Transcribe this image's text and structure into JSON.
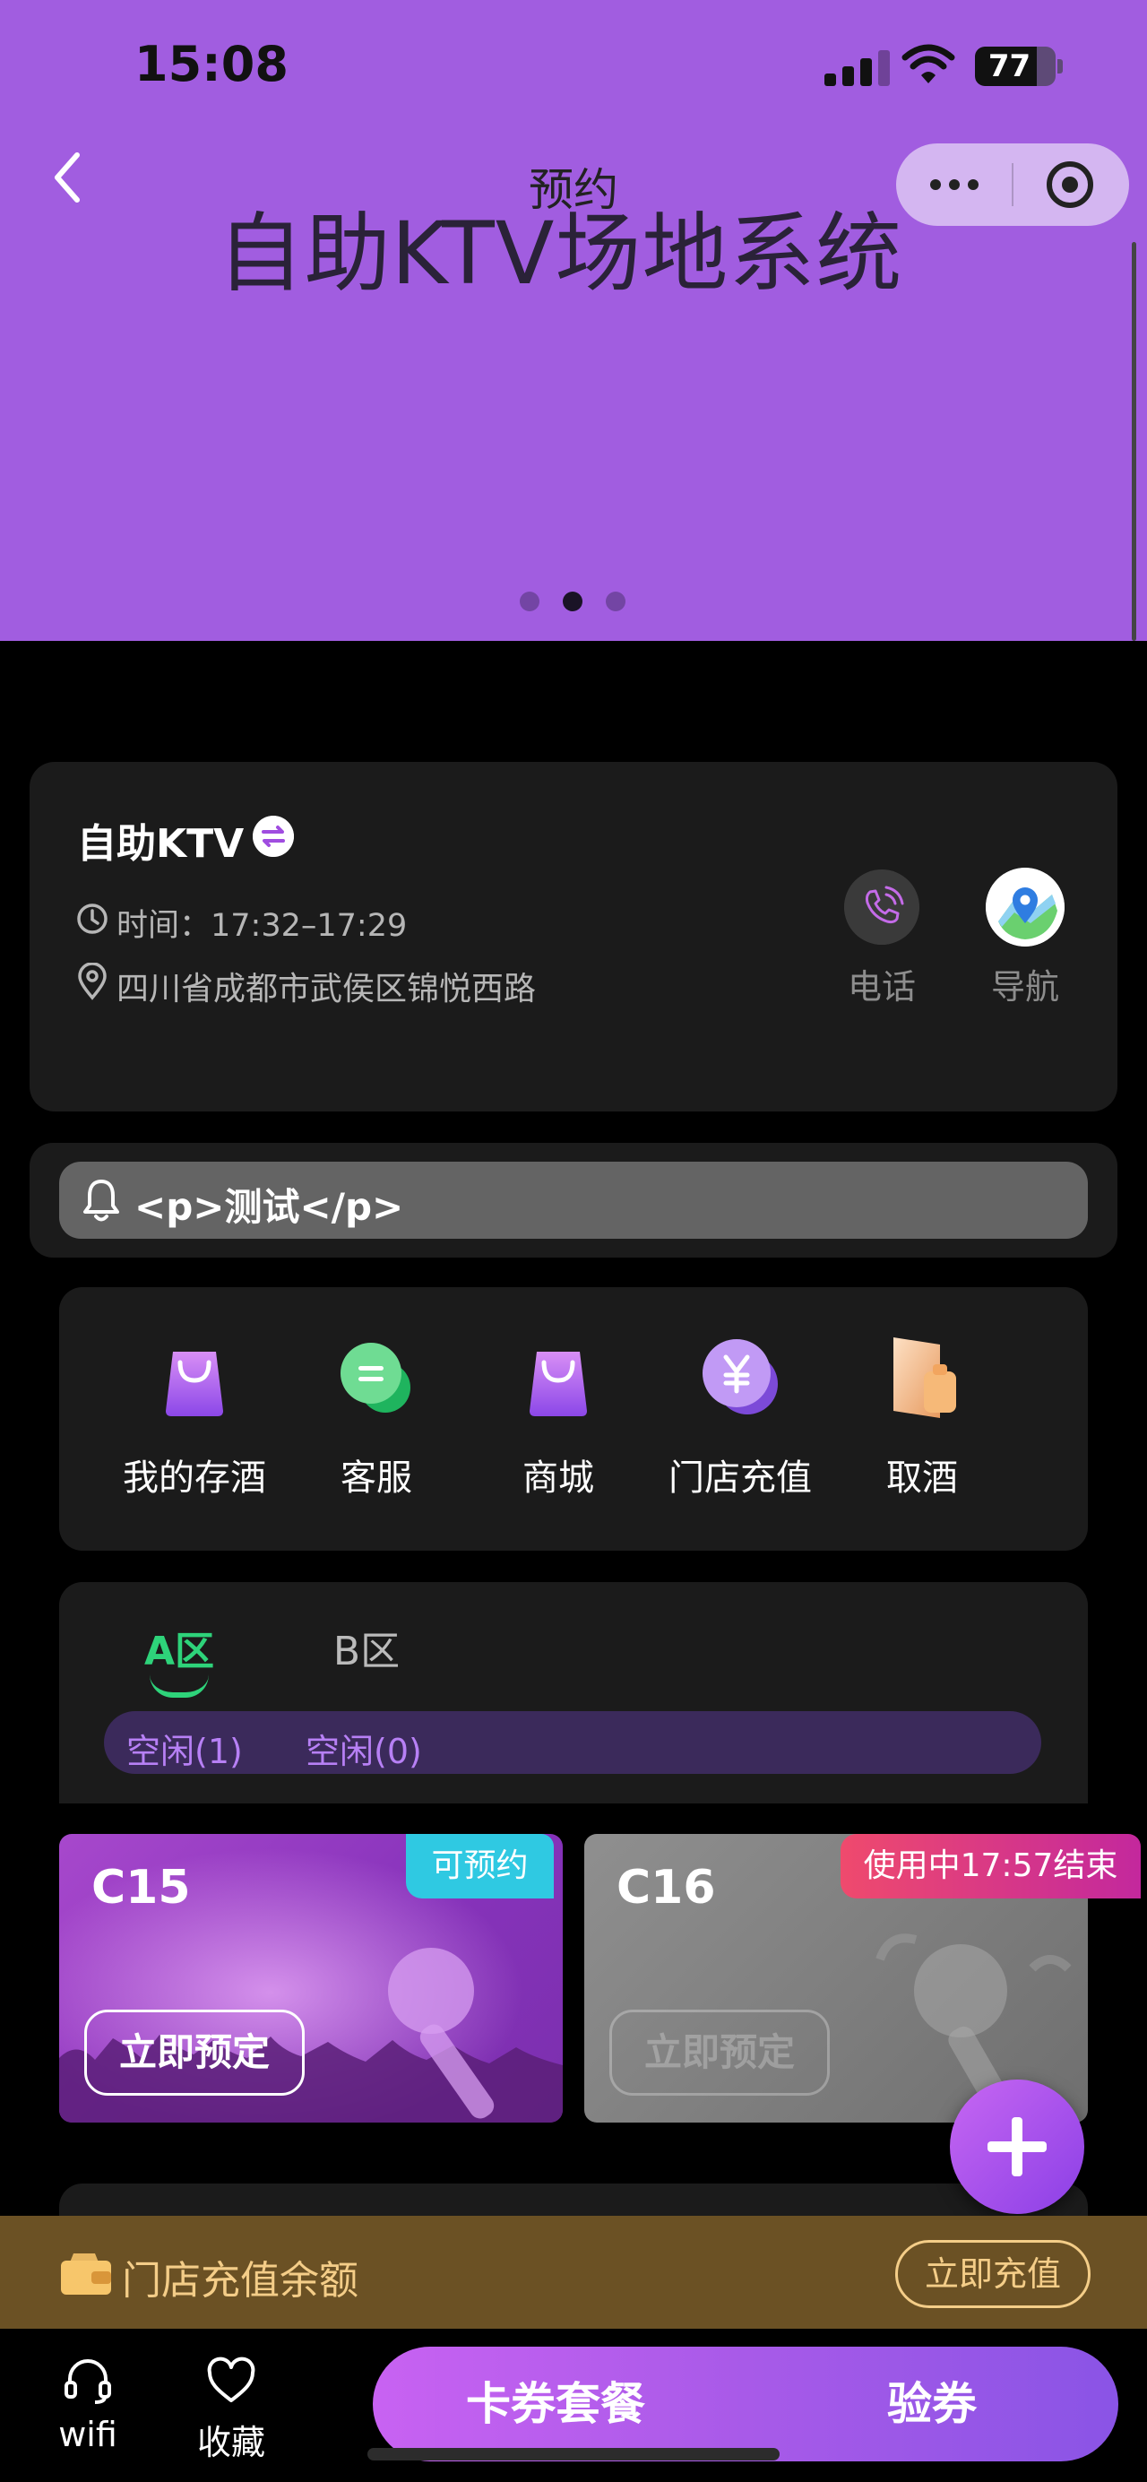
{
  "status_bar": {
    "time": "15:08",
    "battery_level": "77",
    "battery_fraction": 0.77
  },
  "nav": {
    "title": "预约"
  },
  "banner": {
    "text": "自助KTV场地系统",
    "slide_count": 3,
    "active_slide": 2
  },
  "store": {
    "name": "自助KTV",
    "hours": "时间：17:32–17:29",
    "address": "四川省成都市武侯区锦悦西路",
    "phone_label": "电话",
    "nav_label": "导航"
  },
  "notice": {
    "text": "<p>测试</p>"
  },
  "quick_menu": [
    {
      "label": "我的存酒",
      "icon": "bag-icon"
    },
    {
      "label": "客服",
      "icon": "chat-icon"
    },
    {
      "label": "商城",
      "icon": "shop-bag-icon"
    },
    {
      "label": "门店充值",
      "icon": "yuan-coin-icon"
    },
    {
      "label": "取酒",
      "icon": "wine-pickup-icon"
    }
  ],
  "zones": {
    "tabs": [
      {
        "label": "A区",
        "active": true
      },
      {
        "label": "B区",
        "active": false
      }
    ],
    "status": [
      "空闲(1)",
      "空闲(0)"
    ]
  },
  "rooms": [
    {
      "name": "C15",
      "badge": "可预约",
      "button": "立即预定",
      "available": true
    },
    {
      "name": "C16",
      "badge": "使用中17:57结束",
      "button": "立即预定",
      "available": false
    }
  ],
  "recharge": {
    "label": "门店充值余额",
    "button": "立即充值"
  },
  "bottom_nav": {
    "wifi_label": "wifi",
    "favorite_label": "收藏",
    "coupon_label": "卡券套餐",
    "verify_label": "验券"
  },
  "colors": {
    "banner": "#a15de0",
    "accent_green": "#2ed37a",
    "accent_purple": "#b780f5",
    "badge_available": "#2fc9e2",
    "badge_in_use": "#ef4a6d",
    "recharge_gold": "#f4cd88"
  }
}
